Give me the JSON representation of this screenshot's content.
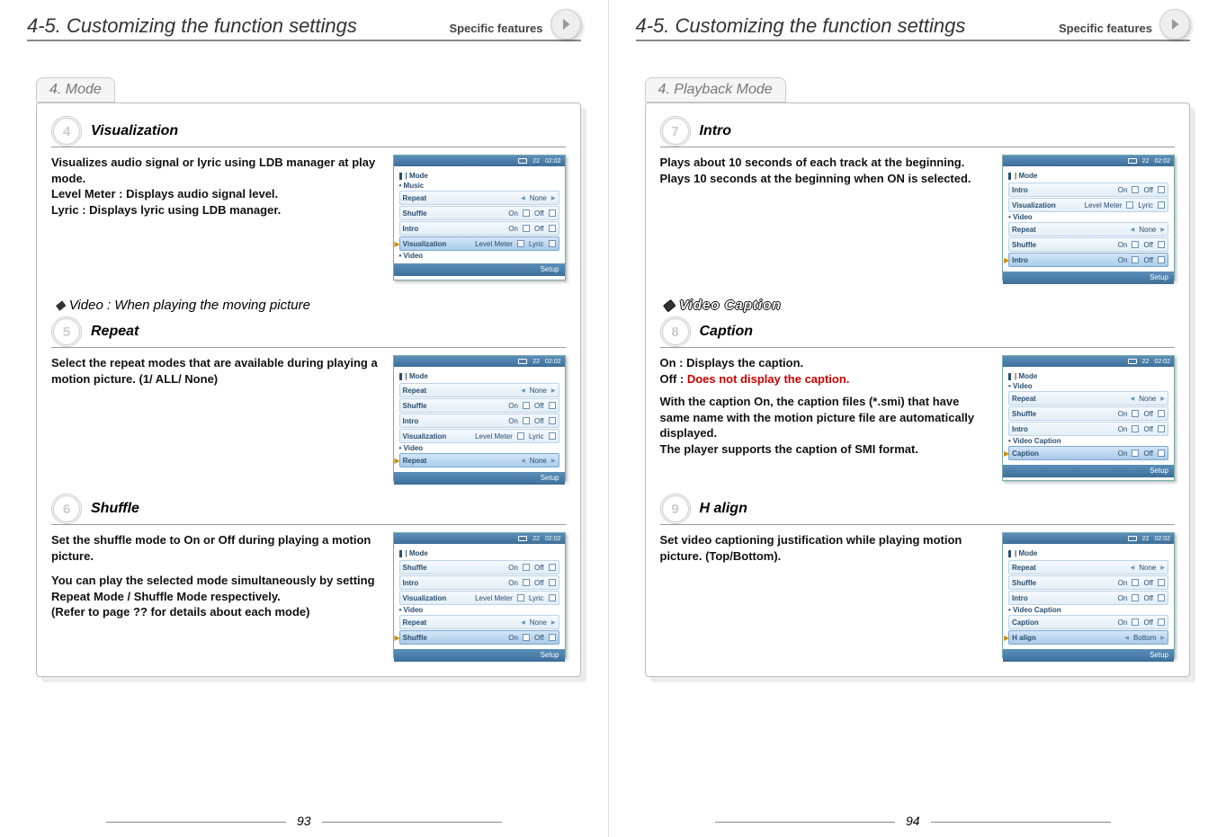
{
  "chapter": {
    "num": "4-5.",
    "title": "Customizing the function settings",
    "tag": "Specific features"
  },
  "pages": {
    "left": "93",
    "right": "94"
  },
  "left": {
    "section": "4. Mode",
    "s4": {
      "title": "Visualization",
      "desc1": "Visualizes audio signal or lyric using LDB manager at play mode.",
      "desc2": "Level Meter : Displays audio signal level.\nLyric : Displays lyric using LDB manager."
    },
    "sub_video": "Video : When playing the moving picture",
    "s5": {
      "title": "Repeat",
      "desc": "Select the repeat modes that are available during playing a motion picture. (1/ ALL/ None)"
    },
    "s6": {
      "title": "Shuffle",
      "desc1": "Set the shuffle mode to On or Off during playing a motion picture.",
      "desc2": "You can play the selected mode simultaneously by setting Repeat Mode / Shuffle Mode respectively.\n(Refer to page ?? for details about each mode)"
    }
  },
  "right": {
    "section": "4. Playback Mode",
    "s7": {
      "title": "Intro",
      "desc": "Plays about 10 seconds of each track at the beginning.\nPlays 10 seconds at the beginning when ON is selected."
    },
    "sub_caption": "Video Caption",
    "s8": {
      "title": "Caption",
      "line1": "On : Displays the caption.",
      "line2_a": "Off : ",
      "line2_b": "Does not display the caption.",
      "desc": "With the caption On, the caption files (*.smi) that have same name with the motion picture file are automatically displayed.\nThe player supports the caption of SMI format."
    },
    "s9": {
      "title": "H align",
      "desc": "Set video captioning justification while playing motion picture. (Top/Bottom)."
    }
  },
  "shot": {
    "bar": {
      "battery": "22",
      "time": "02:02"
    },
    "menu": "| Mode",
    "setup": "Setup",
    "items": {
      "music": "Music",
      "video": "Video",
      "videocap": "Video Caption",
      "repeat": {
        "lbl": "Repeat",
        "v": "None"
      },
      "shuffle": {
        "lbl": "Shuffle",
        "on": "On",
        "off": "Off"
      },
      "intro": {
        "lbl": "Intro",
        "on": "On",
        "off": "Off"
      },
      "vis": {
        "lbl": "Visualization",
        "a": "Level Meter",
        "b": "Lyric"
      },
      "caption": {
        "lbl": "Caption",
        "on": "On",
        "off": "Off"
      },
      "halign": {
        "lbl": "H align",
        "v": "Bottom"
      }
    }
  }
}
